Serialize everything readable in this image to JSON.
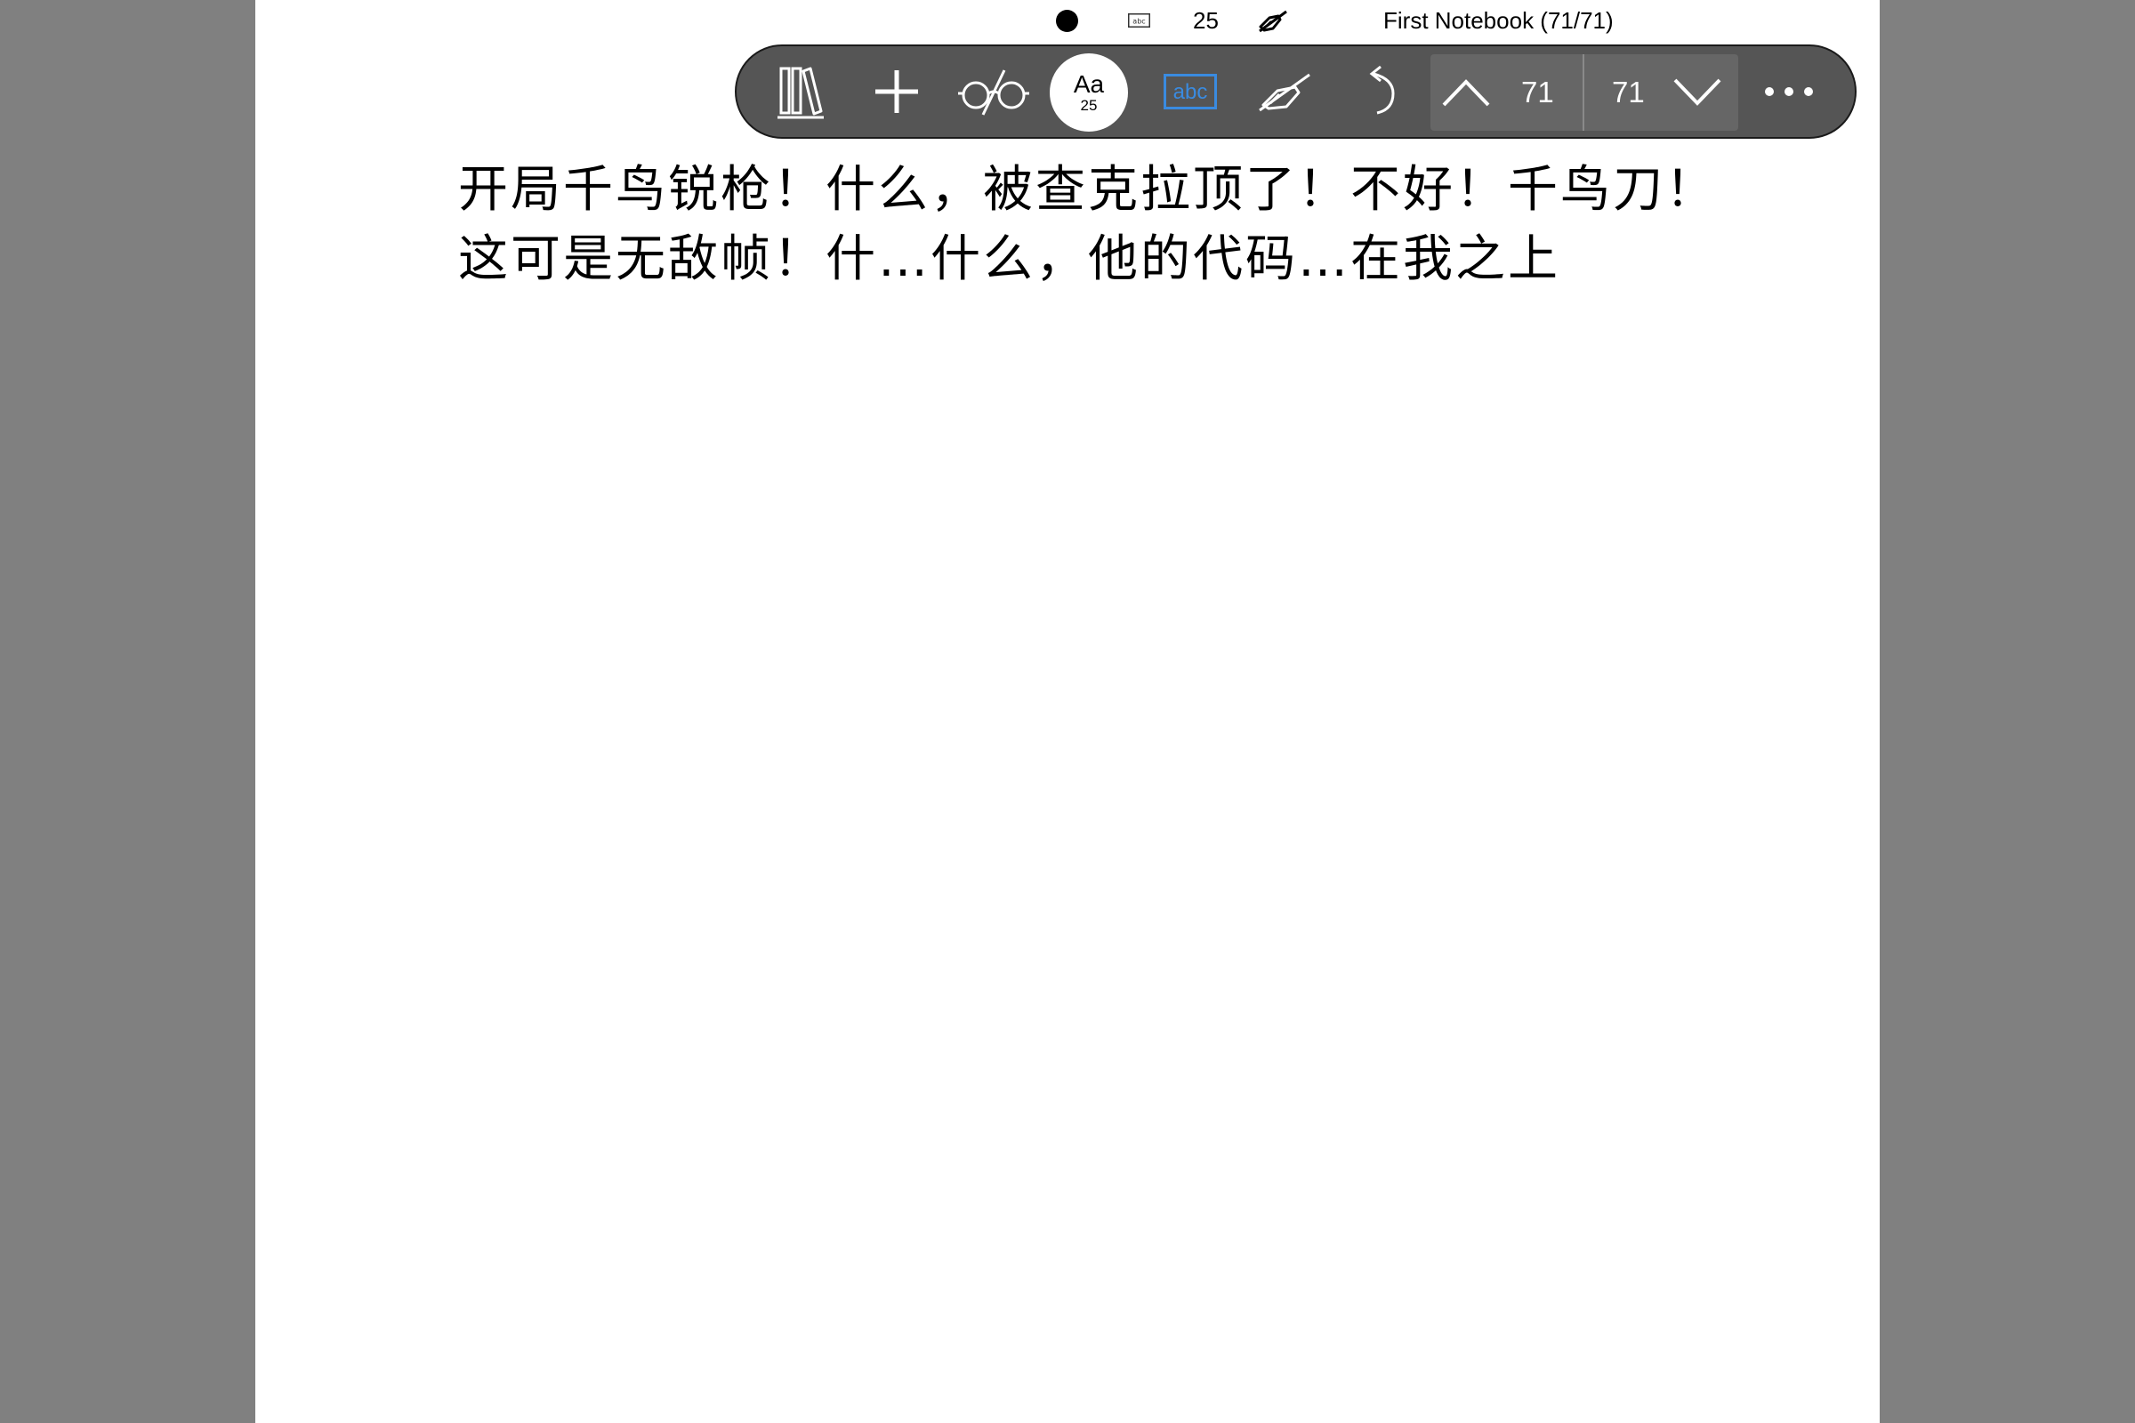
{
  "status_bar": {
    "font_size": "25",
    "notebook_title": "First Notebook (71/71)",
    "icons": [
      "pen-color-dot-icon",
      "text-box-abc-icon",
      "hide-pen-icon"
    ]
  },
  "toolbar": {
    "icons": [
      "library-icon",
      "add-icon",
      "reading-glasses-icon",
      "font-size-icon",
      "text-box-icon",
      "hide-handwriting-icon",
      "undo-icon",
      "page-up-icon",
      "page-down-icon",
      "more-icon"
    ],
    "font_button": {
      "label": "Aa",
      "size": "25"
    },
    "text_box_label": "abc",
    "page_nav": {
      "current": "71",
      "total": "71"
    },
    "accent_color": "#3a8be0"
  },
  "content": {
    "lines": [
      "开局千鸟锐枪！什么，被查克拉顶了！不好！千鸟刀！",
      "这可是无敌帧！什…什么，他的代码…在我之上"
    ]
  }
}
